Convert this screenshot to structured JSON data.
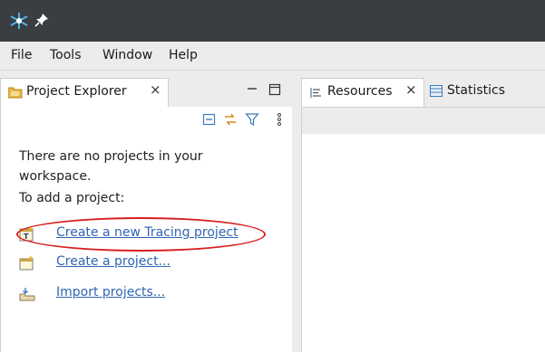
{
  "titlebar": {
    "logo_icon": "trace-compass-logo-icon",
    "pin_icon": "pin-icon"
  },
  "menu": {
    "items": [
      "File",
      "Tools",
      "Window",
      "Help"
    ]
  },
  "explorer": {
    "tab_label": "Project Explorer",
    "tab_icon": "project-explorer-icon",
    "close_glyph": "×",
    "toolbar_icons": [
      "collapse-all-icon",
      "link-with-editor-icon",
      "filter-icon",
      "view-menu-icon"
    ],
    "message_line1": "There are no projects in your",
    "message_line2": "workspace.",
    "message_line3": "To add a project:",
    "links": [
      {
        "label": "Create a new Tracing project",
        "icon": "new-tracing-project-icon"
      },
      {
        "label": "Create a project...",
        "icon": "new-project-icon"
      },
      {
        "label": "Import projects...",
        "icon": "import-projects-icon"
      }
    ]
  },
  "editor": {
    "tabs": [
      {
        "label": "Resources",
        "icon": "resources-icon",
        "active": true
      },
      {
        "label": "Statistics",
        "icon": "statistics-icon",
        "active": false
      }
    ]
  },
  "colors": {
    "titlebar": "#3a3d41",
    "chrome": "#ececec",
    "link": "#2f66b3",
    "highlight": "#d81e1e"
  }
}
